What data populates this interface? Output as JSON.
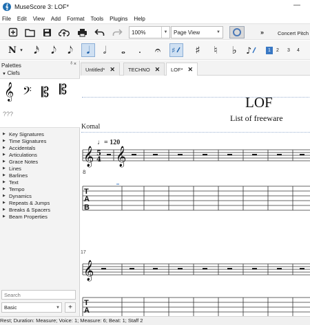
{
  "window": {
    "title": "MuseScore 3: LOF*",
    "minimize_label": "—"
  },
  "menu": [
    "File",
    "Edit",
    "View",
    "Add",
    "Format",
    "Tools",
    "Plugins",
    "Help"
  ],
  "toolbar": {
    "zoom_value": "100%",
    "view_mode": "Page View",
    "more_label": "»",
    "concert_pitch_label": "Concert Pitch"
  },
  "note_input": {
    "durations": [
      "N",
      "▾",
      "𝅘𝅥𝅯",
      "𝅘𝅥𝅮",
      "𝅘𝅥𝅮",
      "𝅘𝅥",
      "𝅗𝅥",
      "𝅝",
      ".",
      "𝄐",
      "♯",
      "♮",
      "♭"
    ],
    "voices": [
      "1",
      "2",
      "3",
      "4"
    ],
    "active_voice": "1"
  },
  "palette": {
    "title": "Palettes",
    "close_label": "ᵟ ×",
    "clefs_title": "Clefs",
    "clef_symbols": [
      "𝄞",
      "𝄢",
      "𝄡",
      "𝄡"
    ],
    "clef_more": "???",
    "sections": [
      "Key Signatures",
      "Time Signatures",
      "Accidentals",
      "Articulations",
      "Grace Notes",
      "Lines",
      "Barlines",
      "Text",
      "Tempo",
      "Dynamics",
      "Repeats & Jumps",
      "Breaks & Spacers",
      "Beam Properties"
    ],
    "search_placeholder": "Search",
    "workspace_value": "Basic",
    "add_label": "+"
  },
  "tabs": [
    {
      "label": "Untitled*",
      "close": "✕",
      "active": false
    },
    {
      "label": "TECHNO",
      "close": "✕",
      "active": false
    },
    {
      "label": "LOF*",
      "close": "✕",
      "active": true
    }
  ],
  "score": {
    "title": "LOF",
    "subtitle": "List of freeware",
    "composer": "Komal",
    "tempo": "♩= 120",
    "time_signature": "5/4",
    "measure_number": "17"
  },
  "status": {
    "text": "Rest; Duration: Measure; Voice: 1;  Measure: 6; Beat: 1; Staff 2"
  },
  "colors": {
    "accent": "#3978c4",
    "page_border": "#9ab0d1"
  }
}
